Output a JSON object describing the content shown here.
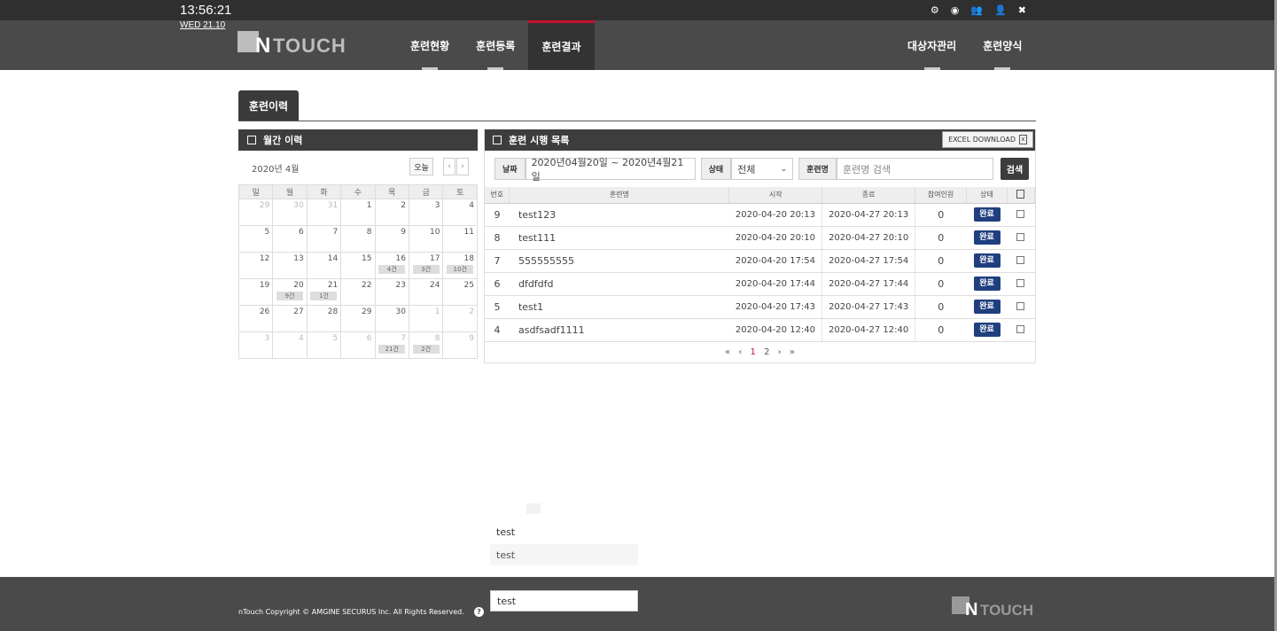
{
  "clock": {
    "time": "13:56:21",
    "date": "WED  21.10"
  },
  "top_icons": [
    "gear-icon",
    "eye-icon",
    "user-plus-icon",
    "user-icon",
    "close-icon"
  ],
  "logo": {
    "n": "N",
    "rest": "TOUCH"
  },
  "nav": {
    "left": [
      "훈련현황",
      "훈련등록",
      "훈련결과"
    ],
    "active": "훈련결과",
    "right": [
      "대상자관리",
      "훈련양식"
    ]
  },
  "section_tab": "훈련이력",
  "calendar": {
    "title": "월간 이력",
    "month": "2020년 4월",
    "today_label": "오늘",
    "prev": "‹",
    "next": "›",
    "weekdays": [
      "일",
      "월",
      "화",
      "수",
      "목",
      "금",
      "토"
    ],
    "weeks": [
      [
        {
          "d": "29",
          "dim": true
        },
        {
          "d": "30",
          "dim": true
        },
        {
          "d": "31",
          "dim": true
        },
        {
          "d": "1"
        },
        {
          "d": "2"
        },
        {
          "d": "3"
        },
        {
          "d": "4"
        }
      ],
      [
        {
          "d": "5"
        },
        {
          "d": "6"
        },
        {
          "d": "7"
        },
        {
          "d": "8"
        },
        {
          "d": "9"
        },
        {
          "d": "10"
        },
        {
          "d": "11"
        }
      ],
      [
        {
          "d": "12"
        },
        {
          "d": "13"
        },
        {
          "d": "14"
        },
        {
          "d": "15"
        },
        {
          "d": "16",
          "b": "4건"
        },
        {
          "d": "17",
          "b": "3건"
        },
        {
          "d": "18",
          "b": "10건"
        }
      ],
      [
        {
          "d": "19"
        },
        {
          "d": "20",
          "b": "9건"
        },
        {
          "d": "21",
          "b": "1건"
        },
        {
          "d": "22"
        },
        {
          "d": "23"
        },
        {
          "d": "24"
        },
        {
          "d": "25"
        }
      ],
      [
        {
          "d": "26"
        },
        {
          "d": "27"
        },
        {
          "d": "28"
        },
        {
          "d": "29"
        },
        {
          "d": "30"
        },
        {
          "d": "1",
          "dim": true
        },
        {
          "d": "2",
          "dim": true
        }
      ],
      [
        {
          "d": "3",
          "dim": true
        },
        {
          "d": "4",
          "dim": true
        },
        {
          "d": "5",
          "dim": true
        },
        {
          "d": "6",
          "dim": true
        },
        {
          "d": "7",
          "dim": true,
          "b": "21건"
        },
        {
          "d": "8",
          "dim": true,
          "b": "2건"
        },
        {
          "d": "9",
          "dim": true
        }
      ]
    ]
  },
  "list": {
    "title": "훈련 시행 목록",
    "excel_label": "EXCEL DOWNLOAD",
    "filter": {
      "date_label": "날짜",
      "date_value": "2020년04월20일  ~  2020년4월21일",
      "status_label": "상태",
      "status_value": "전체",
      "name_label": "훈련명",
      "name_placeholder": "훈련명 검색",
      "search_label": "검색"
    },
    "headers": [
      "번호",
      "훈련명",
      "시작",
      "종료",
      "참여인원",
      "상태",
      ""
    ],
    "rows": [
      {
        "no": "9",
        "name": "test123",
        "start": "2020-04-20 20:13",
        "end": "2020-04-27 20:13",
        "count": "0",
        "status": "완료"
      },
      {
        "no": "8",
        "name": "test111",
        "start": "2020-04-20 20:10",
        "end": "2020-04-27 20:10",
        "count": "0",
        "status": "완료"
      },
      {
        "no": "7",
        "name": "555555555",
        "start": "2020-04-20 17:54",
        "end": "2020-04-27 17:54",
        "count": "0",
        "status": "완료"
      },
      {
        "no": "6",
        "name": "dfdfdfd",
        "start": "2020-04-20 17:44",
        "end": "2020-04-27 17:44",
        "count": "0",
        "status": "완료"
      },
      {
        "no": "5",
        "name": "test1",
        "start": "2020-04-20 17:43",
        "end": "2020-04-27 17:43",
        "count": "0",
        "status": "완료"
      },
      {
        "no": "4",
        "name": "asdfsadf1111",
        "start": "2020-04-20 12:40",
        "end": "2020-04-27 12:40",
        "count": "0",
        "status": "완료"
      }
    ],
    "pager": {
      "first": "«",
      "prev": "‹",
      "pages": [
        "1",
        "2"
      ],
      "current": "1",
      "next": "›",
      "last": "»"
    }
  },
  "dropdown": {
    "items": [
      "test",
      "test"
    ],
    "input_value": "test"
  },
  "footer": {
    "copyright": "nTouch Copyright © AMGINE SECURUS Inc. All Rights Reserved.",
    "help": "?"
  },
  "colors": {
    "header": "#4a4a4a",
    "accent": "#c8102e",
    "status_done": "#1f3f7f"
  }
}
